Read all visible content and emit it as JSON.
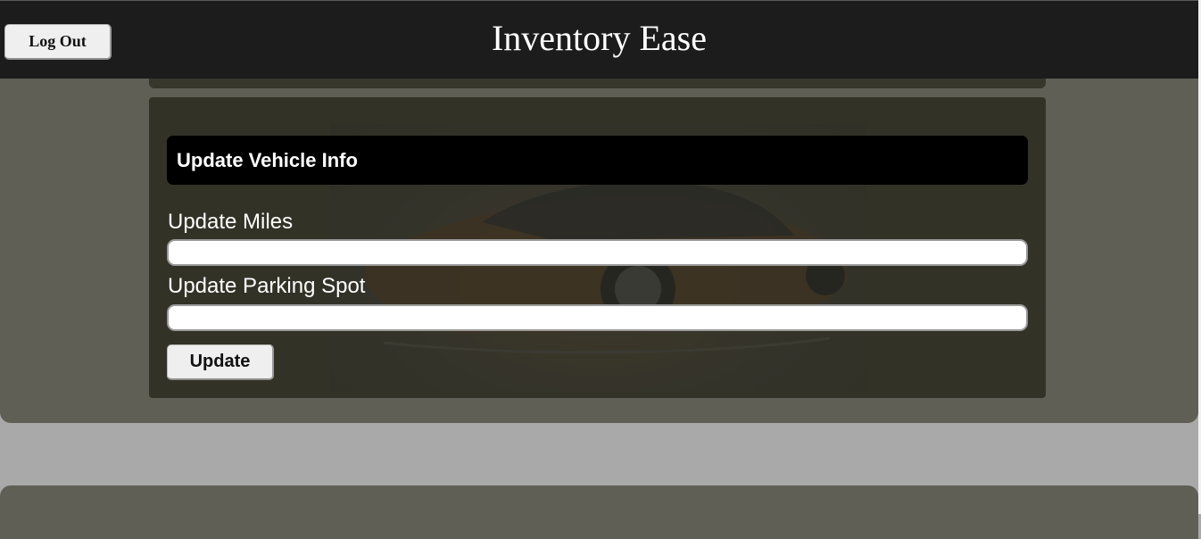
{
  "header": {
    "title": "Inventory Ease",
    "logout_label": "Log Out"
  },
  "form": {
    "title": "Update Vehicle Info",
    "miles_label": "Update Miles",
    "miles_value": "",
    "parking_label": "Update Parking Spot",
    "parking_value": "",
    "submit_label": "Update"
  },
  "colors": {
    "header_bg": "#1c1c1c",
    "section_bg": "#5f5f55",
    "card_bg": "#323227",
    "page_bg": "#a9a9a9",
    "card_title_bg": "#000000"
  },
  "icons": {
    "vehicle_photo": "car-image"
  }
}
